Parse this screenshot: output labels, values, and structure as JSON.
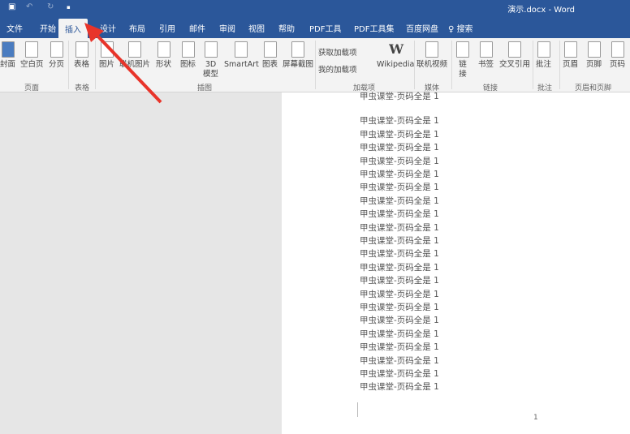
{
  "window": {
    "title": "演示.docx  -  Word",
    "accent": "#2b579a"
  },
  "quick_access": [
    "save-icon",
    "undo-icon",
    "redo-icon",
    "customize-icon"
  ],
  "tabs": [
    {
      "label": "文件"
    },
    {
      "label": "开始"
    },
    {
      "label": "插入"
    },
    {
      "label": "设计"
    },
    {
      "label": "布局"
    },
    {
      "label": "引用"
    },
    {
      "label": "邮件"
    },
    {
      "label": "审阅"
    },
    {
      "label": "视图"
    },
    {
      "label": "帮助"
    },
    {
      "label": "PDF工具"
    },
    {
      "label": "PDF工具集"
    },
    {
      "label": "百度网盘"
    },
    {
      "label": "搜索"
    }
  ],
  "active_tab": "插入",
  "ribbon": {
    "buttons": [
      {
        "label": "封面"
      },
      {
        "label": "空白页"
      },
      {
        "label": "分页"
      },
      {
        "label": "表格"
      },
      {
        "label": "图片"
      },
      {
        "label": "联机图片"
      },
      {
        "label": "形状"
      },
      {
        "label": "图标"
      },
      {
        "label": "3D\n模型"
      },
      {
        "label": "SmartArt"
      },
      {
        "label": "图表"
      },
      {
        "label": "屏幕截图"
      },
      {
        "label": "Wikipedia"
      },
      {
        "label": "联机视频"
      },
      {
        "label": "链\n接"
      },
      {
        "label": "书签"
      },
      {
        "label": "交叉引用"
      },
      {
        "label": "批注"
      },
      {
        "label": "页眉"
      },
      {
        "label": "页脚"
      },
      {
        "label": "页码"
      }
    ],
    "addins": {
      "get": "获取加载项",
      "mine": "我的加载项"
    },
    "groups": [
      {
        "label": "页面"
      },
      {
        "label": "表格"
      },
      {
        "label": "插图"
      },
      {
        "label": "加载项"
      },
      {
        "label": "媒体"
      },
      {
        "label": "链接"
      },
      {
        "label": "批注"
      },
      {
        "label": "页眉和页脚"
      }
    ]
  },
  "document": {
    "lines": [
      "甲虫课堂-页码全是 1",
      "甲虫课堂-页码全是 1",
      "甲虫课堂-页码全是 1",
      "甲虫课堂-页码全是 1",
      "甲虫课堂-页码全是 1",
      "甲虫课堂-页码全是 1",
      "甲虫课堂-页码全是 1",
      "甲虫课堂-页码全是 1",
      "甲虫课堂-页码全是 1",
      "甲虫课堂-页码全是 1",
      "甲虫课堂-页码全是 1",
      "甲虫课堂-页码全是 1",
      "甲虫课堂-页码全是 1",
      "甲虫课堂-页码全是 1",
      "甲虫课堂-页码全是 1",
      "甲虫课堂-页码全是 1",
      "甲虫课堂-页码全是 1",
      "甲虫课堂-页码全是 1",
      "甲虫课堂-页码全是 1",
      "甲虫课堂-页码全是 1",
      "甲虫课堂-页码全是 1",
      "甲虫课堂-页码全是 1"
    ],
    "page_number": "1"
  },
  "annotation": {
    "arrow_color": "#e8342a"
  }
}
